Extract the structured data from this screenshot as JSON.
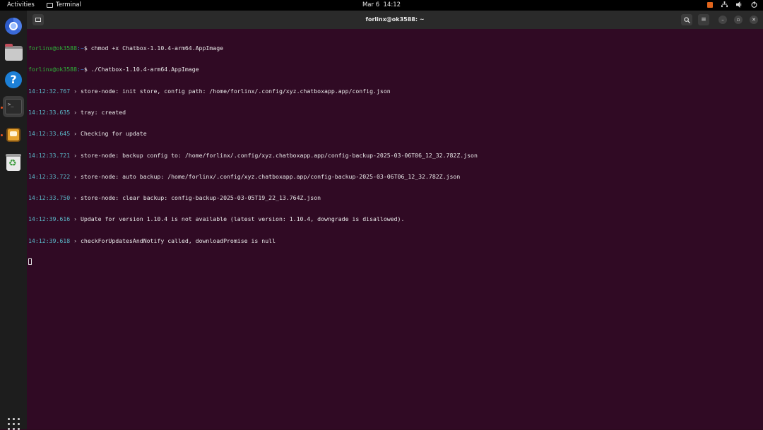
{
  "topbar": {
    "activities": "Activities",
    "app_name": "Terminal",
    "date": "Mar 6",
    "time": "14:12"
  },
  "window": {
    "title": "forlinx@ok3588: ~"
  },
  "prompt": {
    "user_host": "forlinx@ok3588",
    "path": ":~",
    "symbol": "$"
  },
  "commands": [
    "chmod +x Chatbox-1.10.4-arm64.AppImage",
    "./Chatbox-1.10.4-arm64.AppImage"
  ],
  "log": [
    {
      "ts": "14:12:32.767",
      "sep": "›",
      "msg": "store-node: init store, config path: /home/forlinx/.config/xyz.chatboxapp.app/config.json"
    },
    {
      "ts": "14:12:33.635",
      "sep": "›",
      "msg": "tray: created"
    },
    {
      "ts": "14:12:33.645",
      "sep": "›",
      "msg": "Checking for update"
    },
    {
      "ts": "14:12:33.721",
      "sep": "›",
      "msg": "store-node: backup config to: /home/forlinx/.config/xyz.chatboxapp.app/config-backup-2025-03-06T06_12_32.782Z.json"
    },
    {
      "ts": "14:12:33.722",
      "sep": "›",
      "msg": "store-node: auto backup: /home/forlinx/.config/xyz.chatboxapp.app/config-backup-2025-03-06T06_12_32.782Z.json"
    },
    {
      "ts": "14:12:33.750",
      "sep": "›",
      "msg": "store-node: clear backup: config-backup-2025-03-05T19_22_13.764Z.json"
    },
    {
      "ts": "14:12:39.616",
      "sep": "›",
      "msg": "Update for version 1.10.4 is not available (latest version: 1.10.4, downgrade is disallowed)."
    },
    {
      "ts": "14:12:39.618",
      "sep": "›",
      "msg": "checkForUpdatesAndNotify called, downloadPromise is null"
    }
  ],
  "dock": {
    "items": [
      "chrome-icon",
      "files-icon",
      "help-icon",
      "terminal-icon",
      "chatbox-icon",
      "trash-icon"
    ],
    "show_apps_icon": "grid-icon"
  },
  "colors": {
    "terminal_bg": "#300a24",
    "prompt_user": "#2fb03a",
    "prompt_path": "#3b7ed6",
    "timestamp": "#5ab8c8",
    "accent": "#e95420"
  }
}
